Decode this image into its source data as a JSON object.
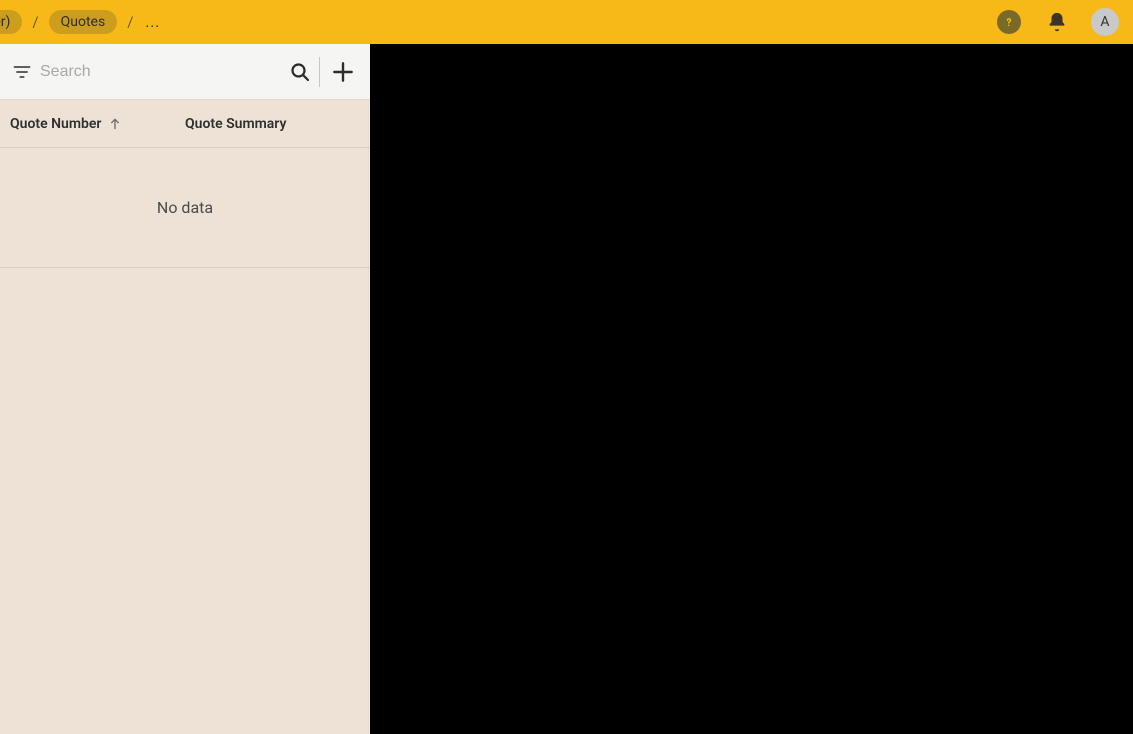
{
  "header": {
    "breadcrumb": {
      "truncated_crumb": "jer)",
      "crumb_quotes": "Quotes",
      "ellipsis": "..."
    },
    "avatar_initial": "A"
  },
  "sidepanel": {
    "search": {
      "placeholder": "Search"
    },
    "columns": {
      "quote_number": "Quote Number",
      "quote_summary": "Quote Summary"
    },
    "no_data": "No data"
  }
}
